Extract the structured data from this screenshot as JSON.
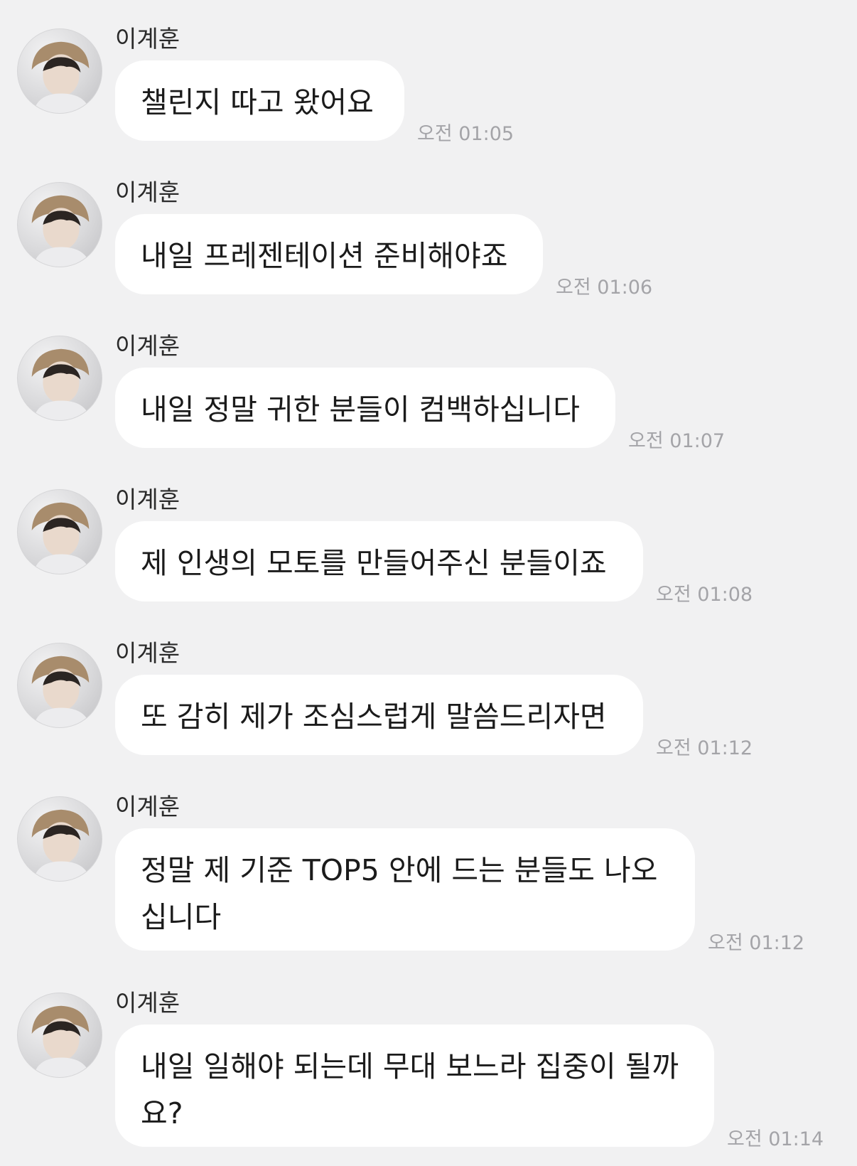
{
  "chat": {
    "messages": [
      {
        "sender": "이계훈",
        "text": "챌린지 따고 왔어요",
        "time": "오전 01:05"
      },
      {
        "sender": "이계훈",
        "text": "내일 프레젠테이션 준비해야죠",
        "time": "오전 01:06"
      },
      {
        "sender": "이계훈",
        "text": "내일 정말 귀한 분들이 컴백하십니다",
        "time": "오전 01:07"
      },
      {
        "sender": "이계훈",
        "text": "제 인생의 모토를 만들어주신 분들이죠",
        "time": "오전 01:08"
      },
      {
        "sender": "이계훈",
        "text": "또 감히 제가 조심스럽게 말씀드리자면",
        "time": "오전 01:12"
      },
      {
        "sender": "이계훈",
        "text": "정말 제 기준 TOP5 안에 드는 분들도 나오\n십니다",
        "time": "오전 01:12"
      },
      {
        "sender": "이계훈",
        "text": "내일 일해야 되는데 무대 보느라 집중이 될까\n요?",
        "time": "오전 01:14"
      }
    ]
  }
}
